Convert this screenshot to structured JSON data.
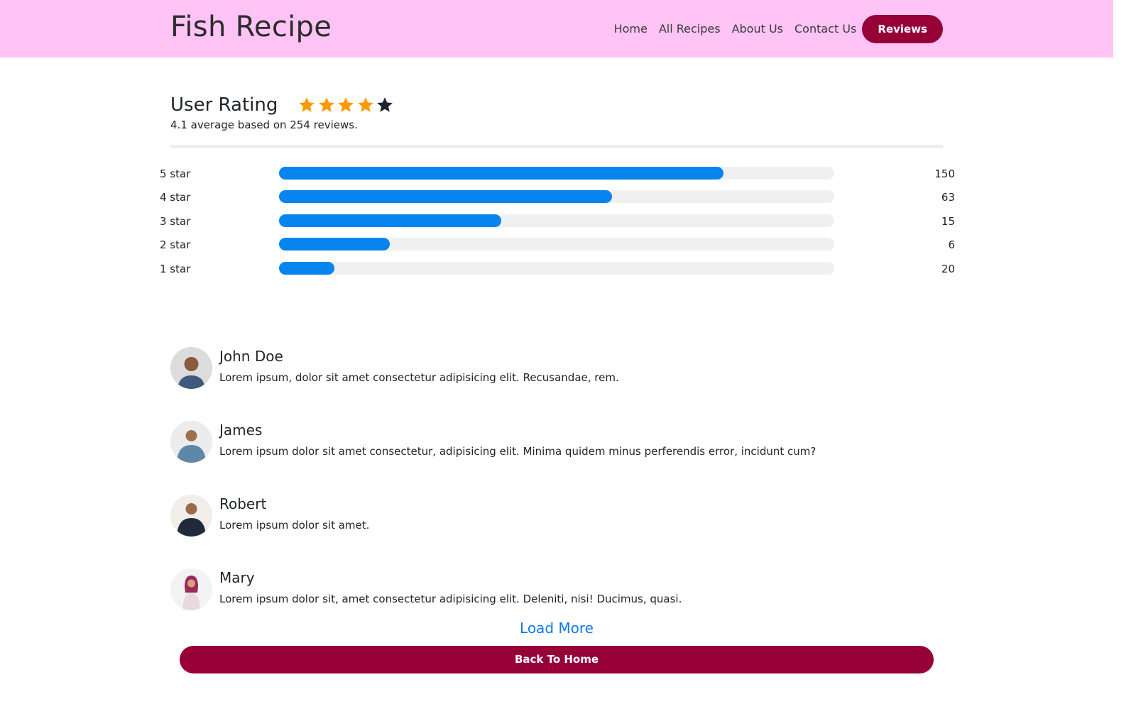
{
  "header": {
    "brand": "Fish Recipe",
    "nav": [
      "Home",
      "All Recipes",
      "About Us",
      "Contact Us",
      "Reviews"
    ],
    "active": "Reviews",
    "background_color": "#ffc4f5",
    "accent_color": "#970037"
  },
  "rating": {
    "title": "User Rating",
    "stars_filled": 4,
    "stars_total": 5,
    "star_color": "#ff9900",
    "summary": "4.1 average based on 254 reviews.",
    "breakdown": [
      {
        "label": "5 star",
        "count": "150",
        "fill_fraction": 0.8
      },
      {
        "label": "4 star",
        "count": "63",
        "fill_fraction": 0.6
      },
      {
        "label": "3 star",
        "count": "15",
        "fill_fraction": 0.4
      },
      {
        "label": "2 star",
        "count": "6",
        "fill_fraction": 0.2
      },
      {
        "label": "1 star",
        "count": "20",
        "fill_fraction": 0.1
      }
    ],
    "bar_color": "#0785ee"
  },
  "reviews": [
    {
      "name": "John Doe",
      "text": "Lorem ipsum, dolor sit amet consectetur adipisicing elit. Recusandae, rem.",
      "avatar_icon": "person-avatar-icon"
    },
    {
      "name": "James",
      "text": "Lorem ipsum dolor sit amet consectetur, adipisicing elit. Minima quidem minus perferendis error, incidunt cum?",
      "avatar_icon": "person-avatar-icon"
    },
    {
      "name": "Robert",
      "text": "Lorem ipsum dolor sit amet.",
      "avatar_icon": "person-avatar-icon"
    },
    {
      "name": "Mary",
      "text": "Lorem ipsum dolor sit, amet consectetur adipisicing elit. Deleniti, nisi! Ducimus, quasi.",
      "avatar_icon": "person-avatar-icon"
    }
  ],
  "load_more": "Load More",
  "back_home": "Back To Home"
}
